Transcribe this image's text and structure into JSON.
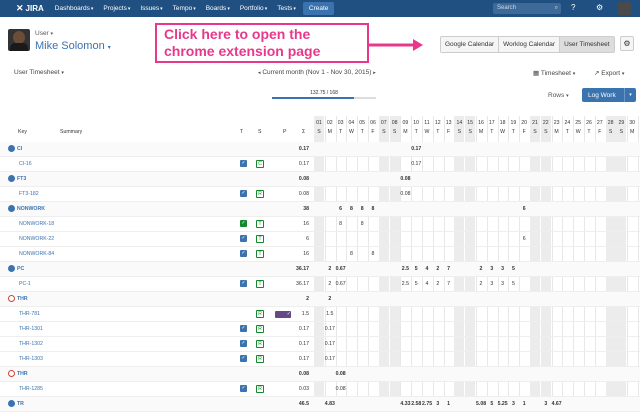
{
  "topbar": {
    "logo": "JIRA",
    "nav": [
      "Dashboards",
      "Projects",
      "Issues",
      "Tempo",
      "Boards",
      "Portfolio",
      "Tests"
    ],
    "create": "Create",
    "search_placeholder": "Search"
  },
  "user": {
    "label": "User",
    "name": "Mike Solomon"
  },
  "callout": {
    "line1": "Click here to open the",
    "line2": "chrome extension page"
  },
  "tabs": [
    "Google Calendar",
    "Worklog Calendar",
    "User Timesheet"
  ],
  "toolbar": {
    "view": "User Timesheet",
    "period": "Current month (Nov 1 - Nov 30, 2015)",
    "timesheet": "Timesheet",
    "export": "Export"
  },
  "progress": {
    "text": "132.75 / 168",
    "fraction": 0.79
  },
  "rows_label": "Rows",
  "log_work": "Log Work",
  "headers": {
    "key": "Key",
    "summary": "Summary",
    "t": "T",
    "s": "S",
    "p": "P",
    "sigma": "Σ"
  },
  "days": [
    [
      "01",
      "S"
    ],
    [
      "02",
      "M"
    ],
    [
      "03",
      "T"
    ],
    [
      "04",
      "W"
    ],
    [
      "05",
      "T"
    ],
    [
      "06",
      "F"
    ],
    [
      "07",
      "S"
    ],
    [
      "08",
      "S"
    ],
    [
      "09",
      "M"
    ],
    [
      "10",
      "T"
    ],
    [
      "11",
      "W"
    ],
    [
      "12",
      "T"
    ],
    [
      "13",
      "F"
    ],
    [
      "14",
      "S"
    ],
    [
      "15",
      "S"
    ],
    [
      "16",
      "M"
    ],
    [
      "17",
      "T"
    ],
    [
      "18",
      "W"
    ],
    [
      "19",
      "T"
    ],
    [
      "20",
      "F"
    ],
    [
      "21",
      "S"
    ],
    [
      "22",
      "S"
    ],
    [
      "23",
      "M"
    ],
    [
      "24",
      "T"
    ],
    [
      "25",
      "W"
    ],
    [
      "26",
      "T"
    ],
    [
      "27",
      "F"
    ],
    [
      "28",
      "S"
    ],
    [
      "29",
      "S"
    ],
    [
      "30",
      "M"
    ]
  ],
  "rows": [
    {
      "key": "CI",
      "group": true,
      "sum": "0.17",
      "vals": {
        "10": "0.17"
      }
    },
    {
      "key": "CI-16",
      "status": "C",
      "sum": "0.17",
      "vals": {
        "10": "0.17"
      }
    },
    {
      "key": "FT3",
      "group": true,
      "sum": "0.08",
      "vals": {
        "9": "0.08"
      }
    },
    {
      "key": "FT3-182",
      "status": "R",
      "sum": "0.08",
      "vals": {
        "9": "0.08"
      }
    },
    {
      "key": "NONWORK",
      "group": true,
      "sum": "38",
      "vals": {
        "3": "6",
        "4": "8",
        "5": "8",
        "6": "8",
        "20": "6"
      }
    },
    {
      "key": "NONWORK-18",
      "chk": "g",
      "status": "T",
      "sum": "16",
      "vals": {
        "3": "8",
        "5": "8"
      }
    },
    {
      "key": "NONWORK-22",
      "status": "T",
      "sum": "6",
      "vals": {
        "20": "6"
      }
    },
    {
      "key": "NONWORK-84",
      "status": "T",
      "sum": "16",
      "vals": {
        "4": "8",
        "6": "8"
      }
    },
    {
      "key": "PC",
      "group": true,
      "sum": "36.17",
      "vals": {
        "2": "2",
        "3": "0.67",
        "9": "2.5",
        "10": "5",
        "11": "4",
        "12": "2",
        "13": "7",
        "16": "2",
        "17": "3",
        "18": "3",
        "19": "5"
      }
    },
    {
      "key": "PC-1",
      "status": "T",
      "p": "",
      "sum": "36.17",
      "vals": {
        "2": "2",
        "3": "0.67",
        "9": "2.5",
        "10": "5",
        "11": "4",
        "12": "2",
        "13": "7",
        "16": "2",
        "17": "3",
        "18": "3",
        "19": "5"
      }
    },
    {
      "key": "THR",
      "group": true,
      "red": true,
      "sum": "2",
      "vals": {
        "2": "2"
      }
    },
    {
      "key": "THR-781",
      "chk": "p",
      "status": "R",
      "sum": "1.5",
      "vals": {
        "2": "1.5"
      }
    },
    {
      "key": "THR-1301",
      "status": "R",
      "sum": "0.17",
      "vals": {
        "2": "0.17"
      }
    },
    {
      "key": "THR-1302",
      "status": "R",
      "sum": "0.17",
      "vals": {
        "2": "0.17"
      }
    },
    {
      "key": "THR-1303",
      "status": "R",
      "sum": "0.17",
      "vals": {
        "2": "0.17"
      }
    },
    {
      "key": "THR",
      "group": true,
      "red": true,
      "sum": "0.08",
      "vals": {
        "3": "0.08"
      }
    },
    {
      "key": "THR-1285",
      "status": "R",
      "sum": "0.03",
      "vals": {
        "3": "0.08"
      }
    },
    {
      "key": "TR",
      "group": true,
      "sum": "46.5",
      "vals": {
        "2": "4.83",
        "9": "4.33",
        "10": "2.58",
        "11": "2.75",
        "12": "3",
        "13": "1",
        "16": "5.08",
        "17": "5",
        "18": "5.25",
        "19": "3",
        "20": "1",
        "22": "3",
        "23": "4.67"
      }
    }
  ]
}
